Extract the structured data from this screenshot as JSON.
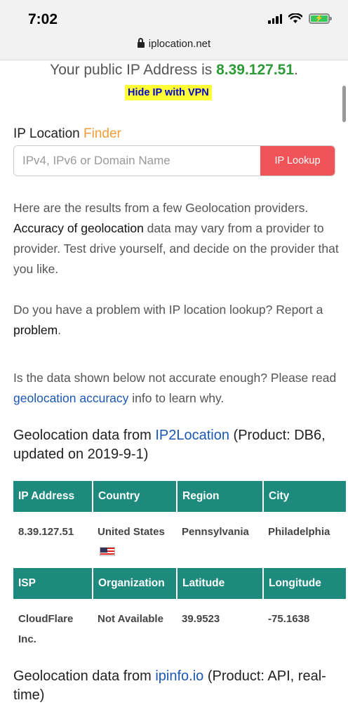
{
  "status_bar": {
    "time": "7:02",
    "battery_level": 1.0
  },
  "browser": {
    "url": "iplocation.net"
  },
  "ip_banner": {
    "prefix": "Your public IP Address is ",
    "ip": "8.39.127.51",
    "suffix": ".",
    "vpn_link": "Hide IP with VPN"
  },
  "finder": {
    "title_1": "IP Location ",
    "title_2": "Finder",
    "placeholder": "IPv4, IPv6 or Domain Name",
    "button": "IP Lookup"
  },
  "intro": {
    "t1": "Here are the results from a few Geolocation providers. ",
    "highlight": "Accuracy of geolocation",
    "t2": " data may vary from a provider to provider. Test drive yourself, and decide on the provider that you like."
  },
  "problem": {
    "t1": "Do you have a problem with IP location lookup? Report a ",
    "link": "problem",
    "t2": "."
  },
  "accuracy": {
    "t1": "Is the data shown below not accurate enough? Please read ",
    "link": "geolocation accuracy",
    "t2": " info to learn why."
  },
  "provider1": {
    "t1": "Geolocation data from ",
    "link": "IP2Location",
    "t2": " (Product: DB6, updated on 2019-9-1)",
    "table": {
      "headers1": [
        "IP Address",
        "Country",
        "Region",
        "City"
      ],
      "row1": [
        "8.39.127.51",
        "United States",
        "Pennsylvania",
        "Philadelphia"
      ],
      "headers2": [
        "ISP",
        "Organization",
        "Latitude",
        "Longitude"
      ],
      "row2": [
        "CloudFlare Inc.",
        "Not Available",
        "39.9523",
        "-75.1638"
      ]
    }
  },
  "provider2": {
    "t1": "Geolocation data from ",
    "link": "ipinfo.io",
    "t2": " (Product: API, real-time)"
  }
}
